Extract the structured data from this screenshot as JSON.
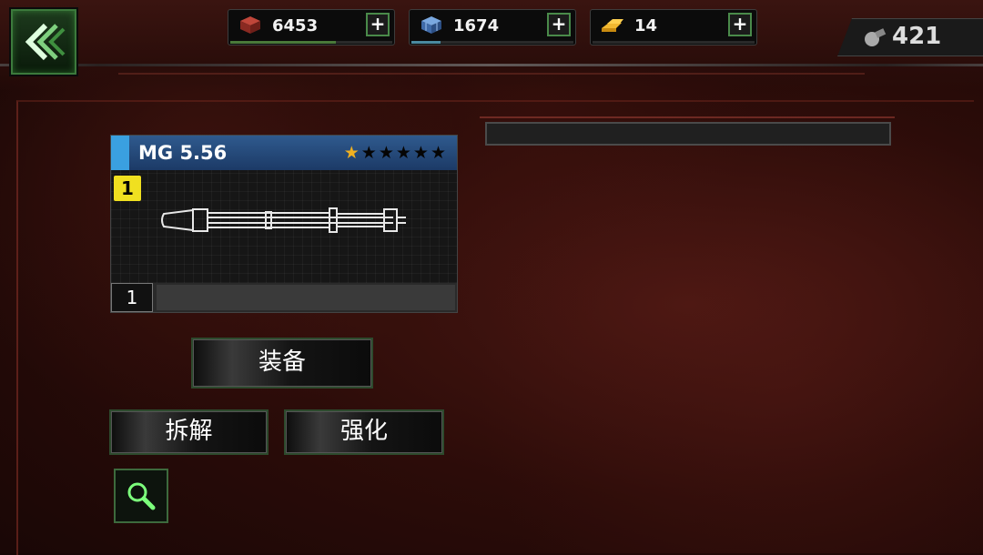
{
  "top_bar": {
    "resources": [
      {
        "name": "red-crate-icon",
        "value": "6453",
        "bar_fill": 0.65,
        "bar_color": "#4a7a3a"
      },
      {
        "name": "blue-crate-icon",
        "value": "1674",
        "bar_fill": 0.18,
        "bar_color": "#4a8aa0"
      },
      {
        "name": "gold-bar-icon",
        "value": "14",
        "bar_fill": 0,
        "bar_color": "#806020"
      }
    ],
    "plus_label": "+",
    "currency": {
      "icon": "grenade-icon",
      "value": "421"
    }
  },
  "weapon": {
    "name": "MG 5.56",
    "stars_total": 6,
    "stars_filled": 1,
    "level_badge": "1",
    "quantity": "1",
    "image": "minigun-icon"
  },
  "actions": {
    "equip": "装备",
    "dismantle": "拆解",
    "upgrade": "强化"
  },
  "colors": {
    "header_blue": "#2f5a8e",
    "badge_yellow": "#f0e020",
    "star_gold": "#f0b020",
    "button_border": "#2d4a2d"
  }
}
